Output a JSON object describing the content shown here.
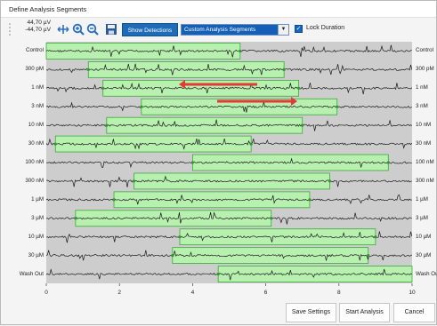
{
  "window": {
    "title": "Define Analysis Segments"
  },
  "toolbar": {
    "scale_top": "44,70 µV",
    "scale_bottom": "-44,70 µV",
    "show_detections_label": "Show Detections",
    "segment_mode_value": "Custom Analysis Segments",
    "lock_duration_label": "Lock Duration",
    "lock_duration_checked": true,
    "icons": [
      "fit-icon",
      "zoom-in-icon",
      "zoom-out-icon",
      "save-icon"
    ]
  },
  "plot": {
    "x_ticks": [
      "0",
      "2",
      "4",
      "6",
      "8",
      "10"
    ],
    "xlim": [
      0,
      10
    ],
    "rows": [
      {
        "label": "Control",
        "right_label": "Control",
        "seg_start": 0.0,
        "seg_end": 5.3
      },
      {
        "label": "300 pM",
        "right_label": "300 pM",
        "seg_start": 1.15,
        "seg_end": 6.5
      },
      {
        "label": "1 nM",
        "right_label": "1 nM",
        "seg_start": 1.55,
        "seg_end": 6.9
      },
      {
        "label": "3 nM",
        "right_label": "3 nM",
        "seg_start": 2.6,
        "seg_end": 7.95
      },
      {
        "label": "10 nM",
        "right_label": "10 nM",
        "seg_start": 1.65,
        "seg_end": 7.0
      },
      {
        "label": "30 nM",
        "right_label": "30 nM",
        "seg_start": 0.25,
        "seg_end": 5.6
      },
      {
        "label": "100 nM",
        "right_label": "100 nM",
        "seg_start": 4.0,
        "seg_end": 9.35
      },
      {
        "label": "300 nM",
        "right_label": "300 nM",
        "seg_start": 2.4,
        "seg_end": 7.75
      },
      {
        "label": "1 µM",
        "right_label": "1 µM",
        "seg_start": 1.85,
        "seg_end": 7.2
      },
      {
        "label": "3 µM",
        "right_label": "3 µM",
        "seg_start": 0.8,
        "seg_end": 6.15
      },
      {
        "label": "10 µM",
        "right_label": "10 µM",
        "seg_start": 3.65,
        "seg_end": 9.0
      },
      {
        "label": "30 µM",
        "right_label": "30 µM",
        "seg_start": 3.45,
        "seg_end": 8.8
      },
      {
        "label": "Wash Out",
        "right_label": "Wash Ou",
        "seg_start": 4.7,
        "seg_end": 10.0
      }
    ],
    "colors": {
      "segment_fill": "#b8f0b0",
      "segment_border": "#3aa83a",
      "trace": "#1a1a1a",
      "background": "#cdcdcd",
      "arrow": "#e53935"
    }
  },
  "buttons": {
    "save_settings": "Save Settings",
    "start_analysis": "Start Analysis",
    "cancel": "Cancel"
  }
}
